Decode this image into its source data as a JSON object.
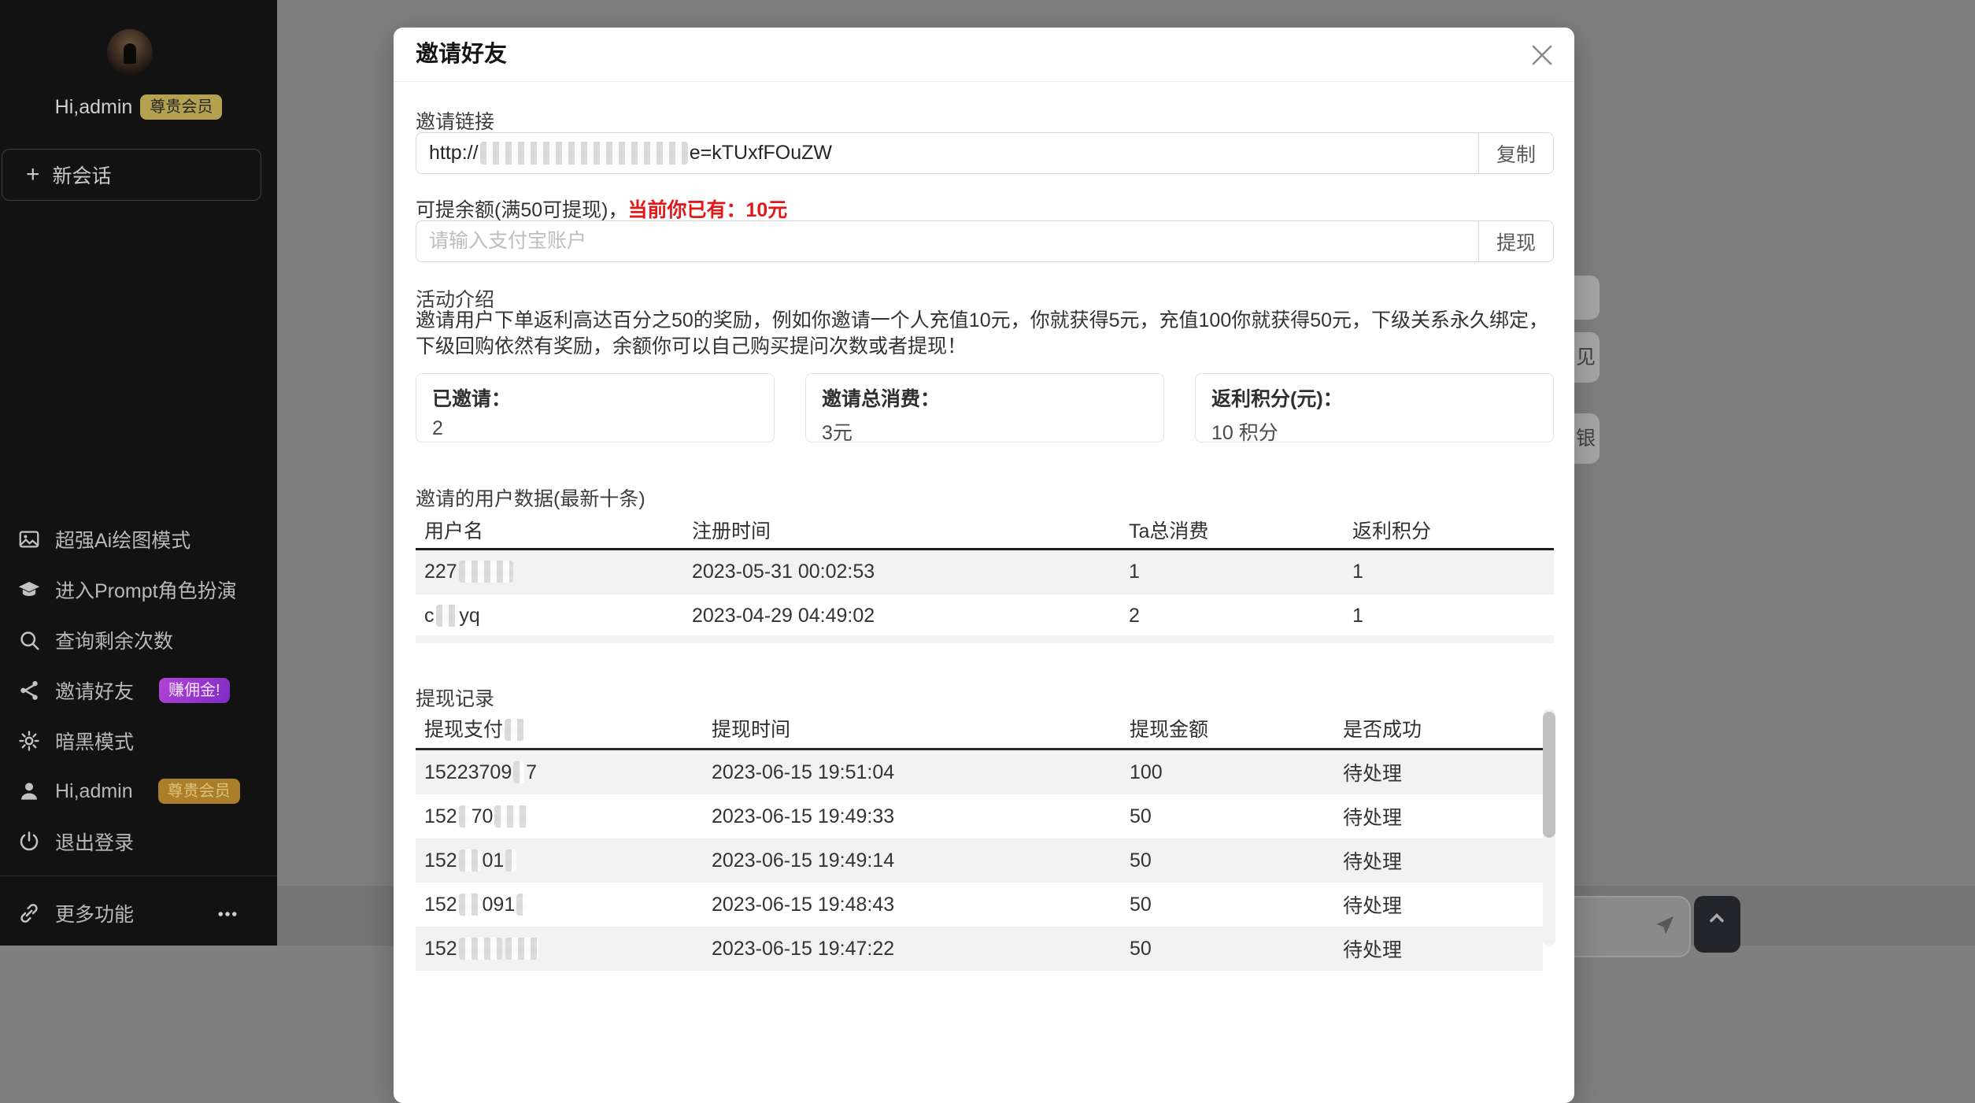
{
  "sidebar": {
    "greeting": "Hi,admin",
    "vip_badge": "尊贵会员",
    "new_chat_label": "新会话",
    "menu": [
      {
        "icon": "image-icon",
        "label": "超强Ai绘图模式"
      },
      {
        "icon": "graduation-cap-icon",
        "label": "进入Prompt角色扮演"
      },
      {
        "icon": "search-icon",
        "label": "查询剩余次数"
      },
      {
        "icon": "share-icon",
        "label": "邀请好友",
        "badge": "赚佣金!",
        "badge_type": "purple"
      },
      {
        "icon": "gear-icon",
        "label": "暗黑模式"
      },
      {
        "icon": "user-icon",
        "label": "Hi,admin",
        "badge": "尊贵会员",
        "badge_type": "amber"
      },
      {
        "icon": "power-icon",
        "label": "退出登录"
      }
    ],
    "more_label": "更多功能"
  },
  "modal": {
    "title": "邀请好友",
    "invite_link": {
      "label": "邀请链接",
      "segments": [
        {
          "t": "http://"
        },
        {
          "t": "0000000000000000000",
          "m": true
        },
        {
          "t": "e=kTUxfFOuZW"
        }
      ],
      "copy_button": "复制"
    },
    "withdraw": {
      "label_plain": "可提余额(满50可提现)，",
      "label_highlight": "当前你已有：10元",
      "placeholder": "请输入支付宝账户",
      "button": "提现"
    },
    "activity": {
      "title": "活动介绍",
      "description": "邀请用户下单返利高达百分之50的奖励，例如你邀请一个人充值10元，你就获得5元，充值100你就获得50元，下级关系永久绑定，下级回购依然有奖励，余额你可以自己购买提问次数或者提现！"
    },
    "stats": [
      {
        "label": "已邀请：",
        "value": "2"
      },
      {
        "label": "邀请总消费：",
        "value": "3元"
      },
      {
        "label": "返利积分(元)：",
        "value": "10 积分"
      }
    ],
    "invited_users": {
      "title": "邀请的用户数据(最新十条)",
      "headers": [
        [
          {
            "t": "用户名"
          }
        ],
        [
          {
            "t": "注册时间"
          }
        ],
        [
          {
            "t": "Ta总消费"
          }
        ],
        [
          {
            "t": "返利积分"
          }
        ]
      ],
      "rows": [
        [
          [
            {
              "t": "227"
            },
            {
              "t": "88883",
              "m": true
            }
          ],
          [
            {
              "t": "2023-05-31 00:02:53"
            }
          ],
          [
            {
              "t": "1"
            }
          ],
          [
            {
              "t": "1"
            }
          ]
        ],
        [
          [
            {
              "t": "c"
            },
            {
              "t": "88",
              "m": true
            },
            {
              "t": "yq"
            }
          ],
          [
            {
              "t": "2023-04-29 04:49:02"
            }
          ],
          [
            {
              "t": "2"
            }
          ],
          [
            {
              "t": "1"
            }
          ]
        ]
      ]
    },
    "withdraw_records": {
      "title": "提现记录",
      "headers": [
        [
          {
            "t": "提现支付"
          },
          {
            "t": "宝",
            "m": true
          }
        ],
        [
          {
            "t": "提现时间"
          }
        ],
        [
          {
            "t": "提现金额"
          }
        ],
        [
          {
            "t": "是否成功"
          }
        ]
      ],
      "rows": [
        [
          [
            {
              "t": "15223709"
            },
            {
              "t": "1",
              "m": true
            },
            {
              "t": "7"
            }
          ],
          [
            {
              "t": "2023-06-15 19:51:04"
            }
          ],
          [
            {
              "t": "100"
            }
          ],
          [
            {
              "t": "待处理"
            }
          ]
        ],
        [
          [
            {
              "t": "152"
            },
            {
              "t": "3",
              "m": true
            },
            {
              "t": "70"
            },
            {
              "t": "888",
              "m": true
            }
          ],
          [
            {
              "t": "2023-06-15 19:49:33"
            }
          ],
          [
            {
              "t": "50"
            }
          ],
          [
            {
              "t": "待处理"
            }
          ]
        ],
        [
          [
            {
              "t": "152"
            },
            {
              "t": "88",
              "m": true
            },
            {
              "t": "01"
            },
            {
              "t": "8",
              "m": true
            }
          ],
          [
            {
              "t": "2023-06-15 19:49:14"
            }
          ],
          [
            {
              "t": "50"
            }
          ],
          [
            {
              "t": "待处理"
            }
          ]
        ],
        [
          [
            {
              "t": "152"
            },
            {
              "t": "88",
              "m": true
            },
            {
              "t": "091"
            },
            {
              "t": "8",
              "m": true
            }
          ],
          [
            {
              "t": "2023-06-15 19:48:43"
            }
          ],
          [
            {
              "t": "50"
            }
          ],
          [
            {
              "t": "待处理"
            }
          ]
        ],
        [
          [
            {
              "t": "152"
            },
            {
              "t": "8788",
              "m": true
            },
            {
              "t": "147",
              "m": true
            }
          ],
          [
            {
              "t": "2023-06-15 19:47:22"
            }
          ],
          [
            {
              "t": "50"
            }
          ],
          [
            {
              "t": "待处理"
            }
          ]
        ]
      ]
    }
  },
  "background": {
    "fragments": [
      "",
      "见",
      "银"
    ]
  },
  "colors": {
    "accent_red": "#e21818",
    "badge_khaki": "#b5a250",
    "badge_amber": "#ab7f2a",
    "badge_purple_start": "#b344d6",
    "badge_purple_end": "#7d2cc4",
    "row_stripe": "#f2f2f2",
    "sidebar_bg": "#121212",
    "overlay_gray": "#7f7f7f"
  }
}
